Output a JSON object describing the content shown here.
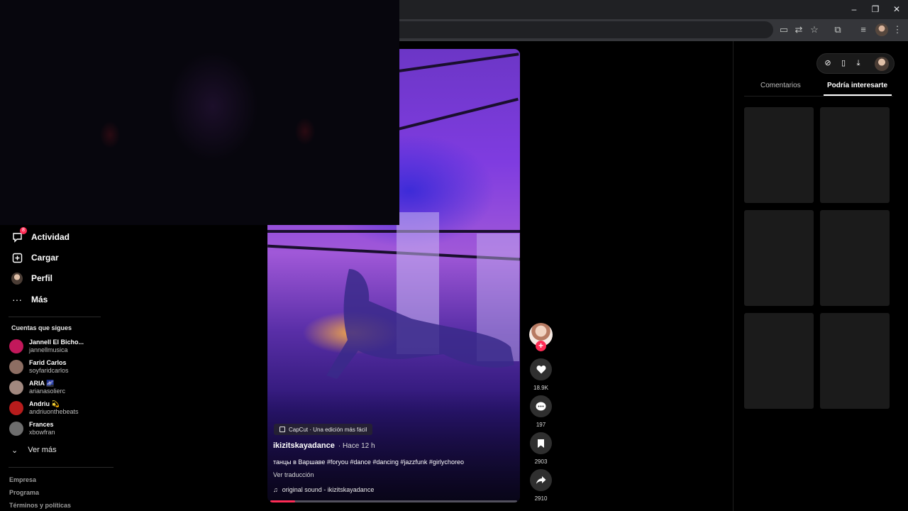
{
  "browser": {
    "window_controls": {
      "minimize": "–",
      "restore": "❐",
      "close": "✕"
    }
  },
  "sidebar": {
    "nav": [
      {
        "label": "Actividad",
        "icon": "activity-icon",
        "badge": "8"
      },
      {
        "label": "Cargar",
        "icon": "upload-icon"
      },
      {
        "label": "Perfil",
        "icon": "profile-avatar"
      },
      {
        "label": "Más",
        "icon": "more-icon"
      }
    ],
    "following_title": "Cuentas que sigues",
    "following": [
      {
        "name": "Jannell El Bicho...",
        "handle": "jannellmusica",
        "avatar_color": "#c2185b"
      },
      {
        "name": "Farid Carlos",
        "handle": "soyfaridcarlos",
        "avatar_color": "#8d6e63"
      },
      {
        "name": "ARIA 🌌",
        "handle": "arianasolierc",
        "avatar_color": "#a1887f"
      },
      {
        "name": "Andriu 💫",
        "handle": "andriuonthebeats",
        "avatar_color": "#b71c1c"
      },
      {
        "name": "Frances",
        "handle": "xbowfran",
        "avatar_color": "#6d6d6d"
      }
    ],
    "see_more": "Ver más",
    "footer": [
      "Empresa",
      "Programa",
      "Términos y políticas"
    ]
  },
  "video": {
    "capcut_label": "CapCut · Una edición más fácil",
    "author": "ikizitskayadance",
    "time": "· Hace 12 h",
    "caption": "танцы в Варшаве #foryou #dance #dancing #jazzfunk #girlychoreo",
    "translate": "Ver traducción",
    "sound": "original sound - ikizitskayadance",
    "progress": 0.1
  },
  "actions": {
    "likes": "18.9K",
    "comments": "197",
    "saves": "2903",
    "shares": "2910"
  },
  "right_panel": {
    "tabs": [
      "Comentarios",
      "Podría interesarte"
    ],
    "active_tab": "Podría interesarte"
  },
  "colors": {
    "accent": "#fe2c55",
    "background": "#000000",
    "card": "#1b1b1b"
  }
}
